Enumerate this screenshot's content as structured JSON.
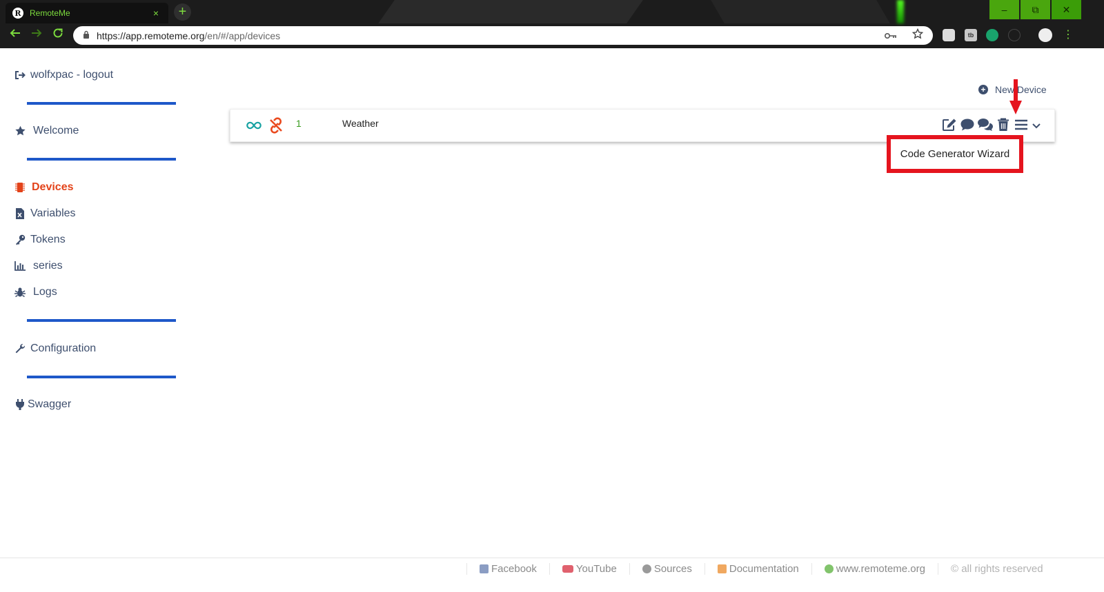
{
  "browser": {
    "tab_title": "RemoteMe",
    "tab_close": "×",
    "new_tab": "+",
    "url_main": "https://app.remoteme.org",
    "url_rest": "/en/#/app/devices",
    "window_controls": {
      "minimize": "–",
      "maximize": "⧉",
      "close": "✕"
    },
    "favicon_letter": "R",
    "ext2_label": "tb"
  },
  "sidebar": {
    "user": "wolfxpac - logout",
    "welcome": "Welcome",
    "devices": "Devices",
    "variables": "Variables",
    "tokens": "Tokens",
    "series": "series",
    "logs": "Logs",
    "configuration": "Configuration",
    "swagger": "Swagger"
  },
  "main": {
    "new_device": "New Device",
    "device": {
      "id": "1",
      "name": "Weather"
    },
    "menu_item": "Code Generator Wizard"
  },
  "footer": {
    "facebook": "Facebook",
    "youtube": "YouTube",
    "sources": "Sources",
    "documentation": "Documentation",
    "website": "www.remoteme.org",
    "copyright": "© all rights reserved"
  },
  "colors": {
    "accent_blue": "#1e58c9",
    "active_red": "#e3431a",
    "highlight_red": "#e5141e",
    "icon_navy": "#3e4f6e",
    "chrome_green": "#7ddc3e"
  }
}
